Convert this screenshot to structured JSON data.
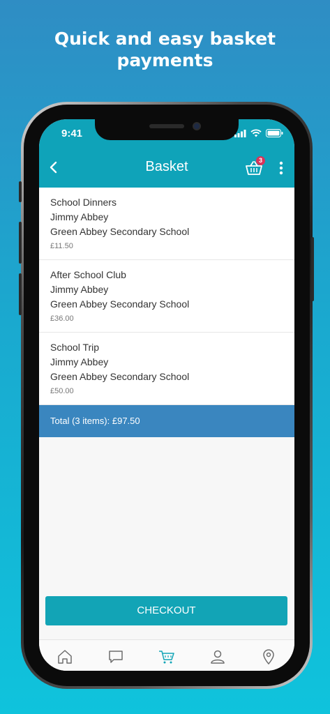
{
  "promo": {
    "line1": "Quick and easy basket",
    "line2": "payments"
  },
  "status_bar": {
    "time": "9:41"
  },
  "header": {
    "title": "Basket",
    "basket_count": "3"
  },
  "items": [
    {
      "title": "School Dinners",
      "child": "Jimmy Abbey",
      "school": "Green Abbey Secondary School",
      "price": "£11.50"
    },
    {
      "title": "After School Club",
      "child": "Jimmy Abbey",
      "school": "Green Abbey Secondary School",
      "price": "£36.00"
    },
    {
      "title": "School Trip",
      "child": "Jimmy Abbey",
      "school": "Green Abbey Secondary School",
      "price": "£50.00"
    }
  ],
  "total": "Total (3 items): £97.50",
  "checkout_label": "CHECKOUT",
  "tabs": [
    {
      "icon": "home-icon"
    },
    {
      "icon": "chat-icon"
    },
    {
      "icon": "basket-icon"
    },
    {
      "icon": "profile-icon"
    },
    {
      "icon": "location-icon"
    }
  ],
  "colors": {
    "accent": "#0fa3b9",
    "total_bar": "#3a86bf",
    "badge": "#d9345a"
  }
}
